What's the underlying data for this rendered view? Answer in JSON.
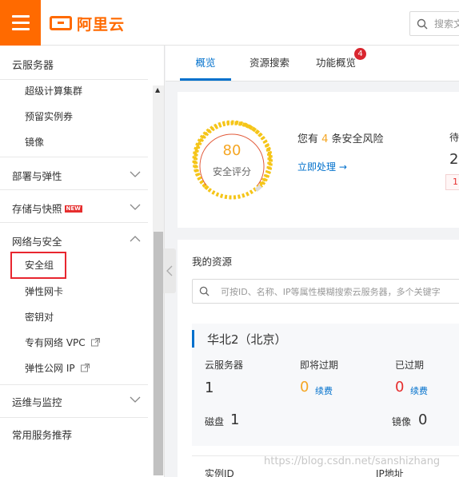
{
  "header": {
    "logo_text": "阿里云",
    "search_placeholder": "搜索文"
  },
  "sidebar": {
    "title": "云服务器",
    "subitems_top": [
      "超级计算集群",
      "预留实例券",
      "镜像"
    ],
    "groups": [
      {
        "label": "部署与弹性",
        "expanded": false
      },
      {
        "label": "存储与快照",
        "badge": "NEW",
        "expanded": false
      },
      {
        "label": "网络与安全",
        "expanded": true
      },
      {
        "label": "运维与监控",
        "expanded": false
      },
      {
        "label": "常用服务推荐"
      }
    ],
    "network_items": [
      "安全组",
      "弹性网卡",
      "密钥对",
      "专有网络 VPC",
      "弹性公网 IP"
    ],
    "active_item": "安全组"
  },
  "tabs": {
    "items": [
      "概览",
      "资源搜索",
      "功能概览"
    ],
    "active": "概览",
    "badge_count": "4"
  },
  "security": {
    "score": "80",
    "score_label": "安全评分",
    "risk_prefix": "您有 ",
    "risk_count": "4",
    "risk_suffix": " 条安全风险",
    "fix_link": "立即处理 →",
    "pending_label": "待",
    "pending_num": "2",
    "pending_tag": "1"
  },
  "resources": {
    "title": "我的资源",
    "search_placeholder": "可按ID、名称、IP等属性模糊搜索云服务器，多个关键字",
    "region": "华北2（北京）",
    "ecs_label": "云服务器",
    "ecs_count": "1",
    "expiring_label": "即将过期",
    "expiring_count": "0",
    "expired_label": "已过期",
    "expired_count": "0",
    "renew_label": "续费",
    "disk_label": "磁盘",
    "disk_count": "1",
    "image_label": "镜像",
    "image_count": "0",
    "table_headers": [
      "实例ID",
      "IP地址"
    ]
  },
  "watermark": "https://blog.csdn.net/sanshizhang",
  "colors": {
    "brand_orange": "#ff6a00",
    "link_blue": "#0070cc",
    "alert_red": "#e62e2e",
    "score_amber": "#f5a623"
  }
}
